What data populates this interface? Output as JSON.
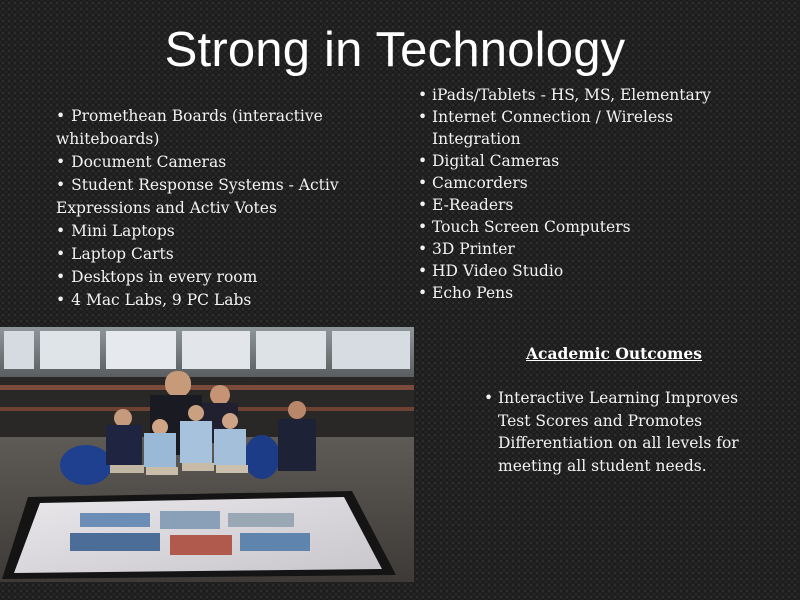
{
  "slide": {
    "title": "Strong in Technology"
  },
  "left_list": [
    "Promethean Boards (interactive whiteboards)",
    "Document Cameras",
    "Student Response Systems  - Activ Expressions and Activ Votes",
    "Mini Laptops",
    "Laptop Carts",
    "Desktops in every room",
    "4 Mac Labs, 9 PC Labs"
  ],
  "right_list": [
    "iPads/Tablets - HS, MS, Elementary",
    "Internet Connection / Wireless Integration",
    "Digital Cameras",
    "Camcorders",
    "E-Readers",
    "Touch Screen Computers",
    "3D Printer",
    "HD Video Studio",
    "Echo Pens"
  ],
  "outcomes": {
    "heading": "Academic Outcomes",
    "items": [
      "Interactive Learning Improves Test Scores and Promotes Differentiation on all levels for meeting all student needs."
    ]
  },
  "colors": {
    "background": "#1b1b1b",
    "text": "#f2f2f2",
    "title": "#ffffff"
  }
}
